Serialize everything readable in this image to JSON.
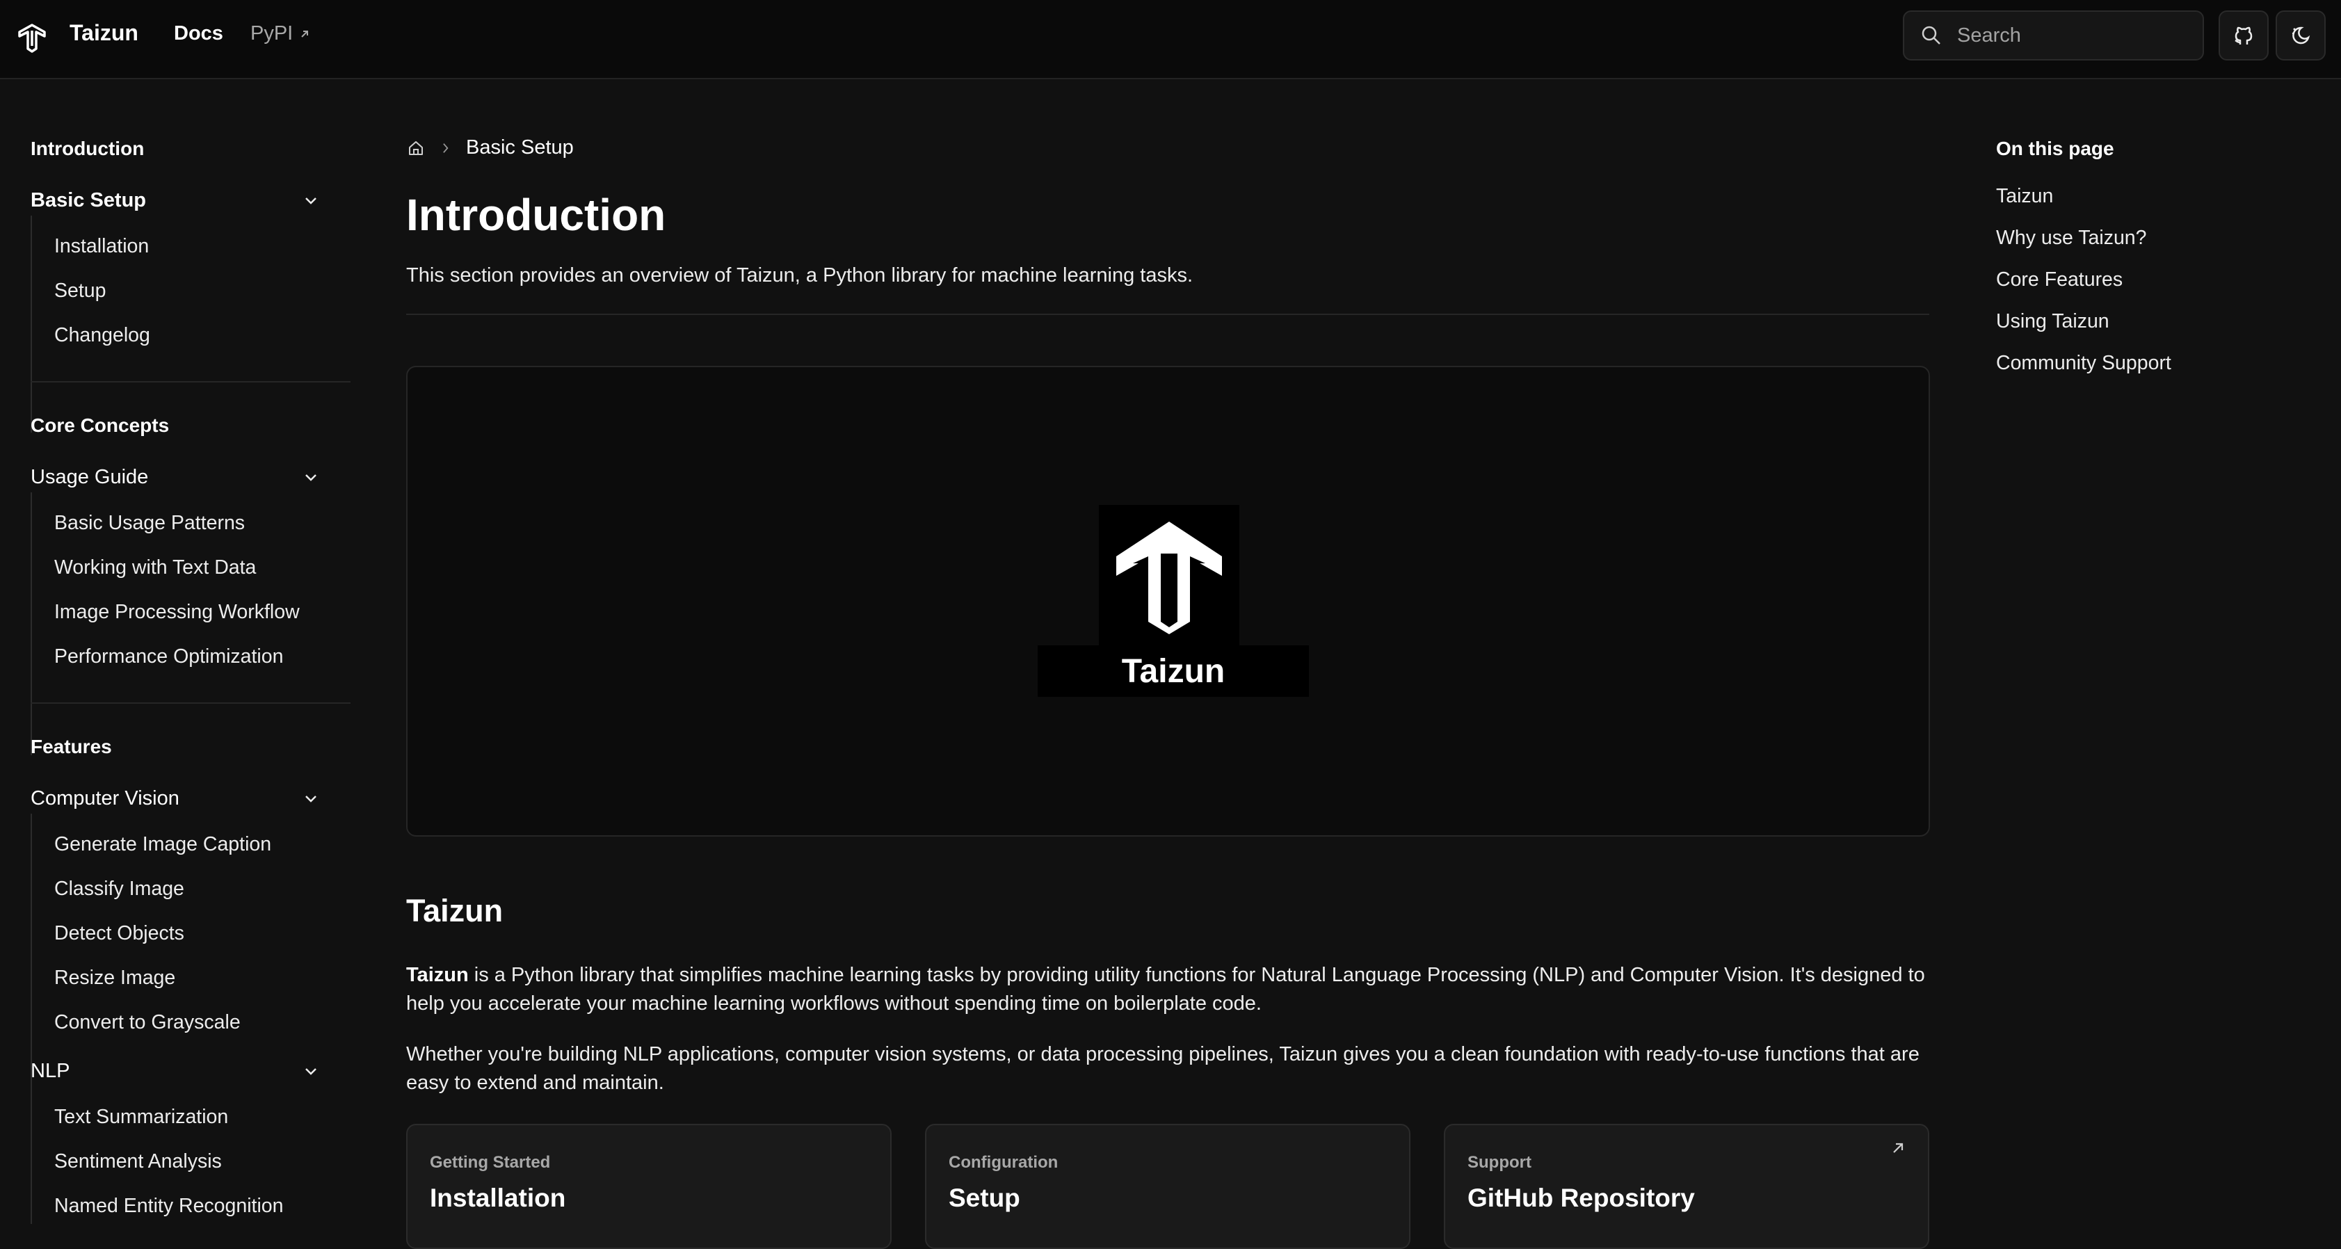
{
  "header": {
    "brand": "Taizun",
    "nav": [
      {
        "label": "Docs"
      },
      {
        "label": "PyPI"
      }
    ],
    "search_placeholder": "Search"
  },
  "sidebar": {
    "sections": [
      {
        "title": "Introduction",
        "groups": [
          {
            "label": "Basic Setup",
            "items": [
              "Installation",
              "Setup",
              "Changelog"
            ]
          }
        ]
      },
      {
        "title": "Core Concepts",
        "groups": [
          {
            "label": "Usage Guide",
            "items": [
              "Basic Usage Patterns",
              "Working with Text Data",
              "Image Processing Workflow",
              "Performance Optimization"
            ]
          }
        ]
      },
      {
        "title": "Features",
        "groups": [
          {
            "label": "Computer Vision",
            "items": [
              "Generate Image Caption",
              "Classify Image",
              "Detect Objects",
              "Resize Image",
              "Convert to Grayscale"
            ]
          },
          {
            "label": "NLP",
            "items": [
              "Text Summarization",
              "Sentiment Analysis",
              "Named Entity Recognition"
            ]
          }
        ]
      }
    ]
  },
  "main": {
    "breadcrumb": "Basic Setup",
    "title": "Introduction",
    "lead": "This section provides an overview of Taizun, a Python library for machine learning tasks.",
    "hero_logo_text": "Taizun",
    "section_heading": "Taizun",
    "para1_bold": "Taizun",
    "para1_rest": " is a Python library that simplifies machine learning tasks by providing utility functions for Natural Language Processing (NLP) and Computer Vision. It's designed to help you accelerate your machine learning workflows without spending time on boilerplate code.",
    "para2": "Whether you're building NLP applications, computer vision systems, or data processing pipelines, Taizun gives you a clean foundation with ready-to-use functions that are easy to extend and maintain.",
    "cards": [
      {
        "kicker": "Getting Started",
        "title": "Installation"
      },
      {
        "kicker": "Configuration",
        "title": "Setup"
      },
      {
        "kicker": "Support",
        "title": "GitHub Repository"
      }
    ]
  },
  "toc": {
    "title": "On this page",
    "items": [
      "Taizun",
      "Why use Taizun?",
      "Core Features",
      "Using Taizun",
      "Community Support"
    ]
  },
  "icons": [
    "taizun-logo-icon",
    "external-link-icon",
    "search-icon",
    "github-icon",
    "theme-toggle-icon",
    "chevron-down-icon",
    "home-icon",
    "chevron-right-icon"
  ]
}
